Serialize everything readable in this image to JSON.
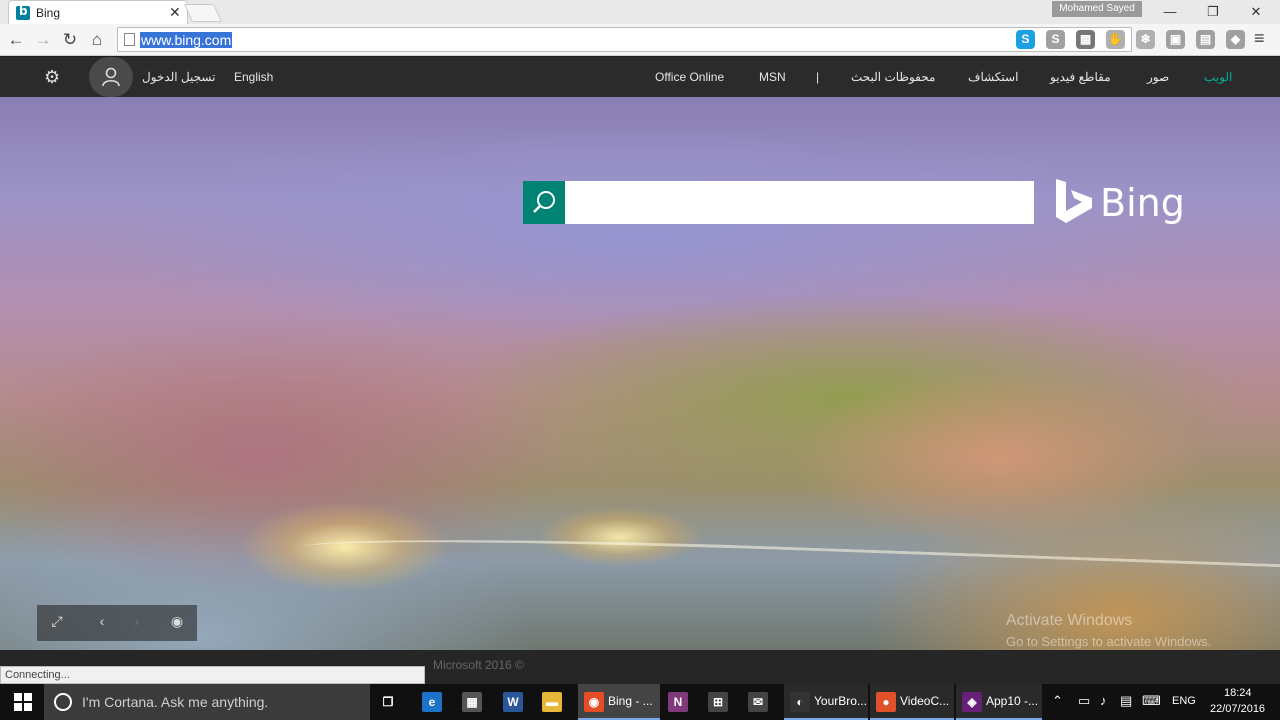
{
  "browser": {
    "tab": {
      "title": "Bing",
      "close": "✕"
    },
    "user_badge": "Mohamed Sayed",
    "window_controls": {
      "minimize": "—",
      "maximize": "❐",
      "close": "✕"
    },
    "nav": {
      "back": "←",
      "forward": "→",
      "reload": "↻",
      "home": "⌂"
    },
    "address": {
      "url": "www.bing.com"
    },
    "star": "☆",
    "menu": "≡",
    "extensions": [
      {
        "name": "skype",
        "glyph": "S",
        "color": "#1ba1e2"
      },
      {
        "name": "skype-grey",
        "glyph": "S",
        "color": "#a0a0a0"
      },
      {
        "name": "qr",
        "glyph": "▦",
        "color": "#777777"
      },
      {
        "name": "hand",
        "glyph": "✋",
        "color": "#b0b0b0"
      },
      {
        "name": "snowflake",
        "glyph": "❄",
        "color": "#b0b0b0"
      },
      {
        "name": "camera",
        "glyph": "▣",
        "color": "#a0a0a0"
      },
      {
        "name": "chat",
        "glyph": "▤",
        "color": "#a0a0a0"
      },
      {
        "name": "diamond",
        "glyph": "◆",
        "color": "#a0a0a0"
      }
    ]
  },
  "bing": {
    "nav": {
      "web": "الويب",
      "images": "صور",
      "videos": "مقاطع فيديو",
      "explore": "استكشاف",
      "saved": "محفوظات البحث",
      "divider": "|",
      "msn": "MSN",
      "office": "Office Online",
      "english": "English",
      "signin": "تسجيل الدخول"
    },
    "search": {
      "value": "",
      "placeholder": ""
    },
    "logo": "Bing",
    "slide_controls": {
      "expand": "⤢",
      "prev": "‹",
      "next": "›",
      "camera": "◉"
    },
    "watermark": {
      "line1": "Activate Windows",
      "line2": "Go to Settings to activate Windows."
    },
    "footer": {
      "copyright": "Microsoft 2016 ©"
    },
    "status": "Connecting..."
  },
  "taskbar": {
    "cortana": "I'm Cortana. Ask me anything.",
    "apps": [
      {
        "name": "chrome",
        "label": "Bing - ...",
        "glyph": "◉",
        "color": "#e44d26"
      },
      {
        "name": "onenote",
        "label": "",
        "glyph": "N",
        "color": "#80397b"
      },
      {
        "name": "store",
        "label": "",
        "glyph": "⊞",
        "color": "#444444"
      },
      {
        "name": "mail",
        "label": "",
        "glyph": "✉",
        "color": "#444444"
      },
      {
        "name": "yourbrowser",
        "label": "YourBro...",
        "glyph": "◐",
        "color": "#333333"
      },
      {
        "name": "videocapture",
        "label": "VideoC...",
        "glyph": "●",
        "color": "#e0502a"
      },
      {
        "name": "visual-studio",
        "label": "App10 -...",
        "glyph": "◈",
        "color": "#68217a"
      }
    ],
    "pinned": [
      {
        "name": "task-view",
        "glyph": "❐",
        "color": "#101010"
      },
      {
        "name": "edge",
        "glyph": "e",
        "color": "#1e72c8"
      },
      {
        "name": "calculator",
        "glyph": "▦",
        "color": "#555555"
      },
      {
        "name": "word",
        "glyph": "W",
        "color": "#2b579a"
      },
      {
        "name": "explorer",
        "glyph": "▬",
        "color": "#e8b73a"
      }
    ],
    "tray": {
      "lang": "ENG",
      "time": "18:24",
      "date": "22/07/2016"
    }
  }
}
